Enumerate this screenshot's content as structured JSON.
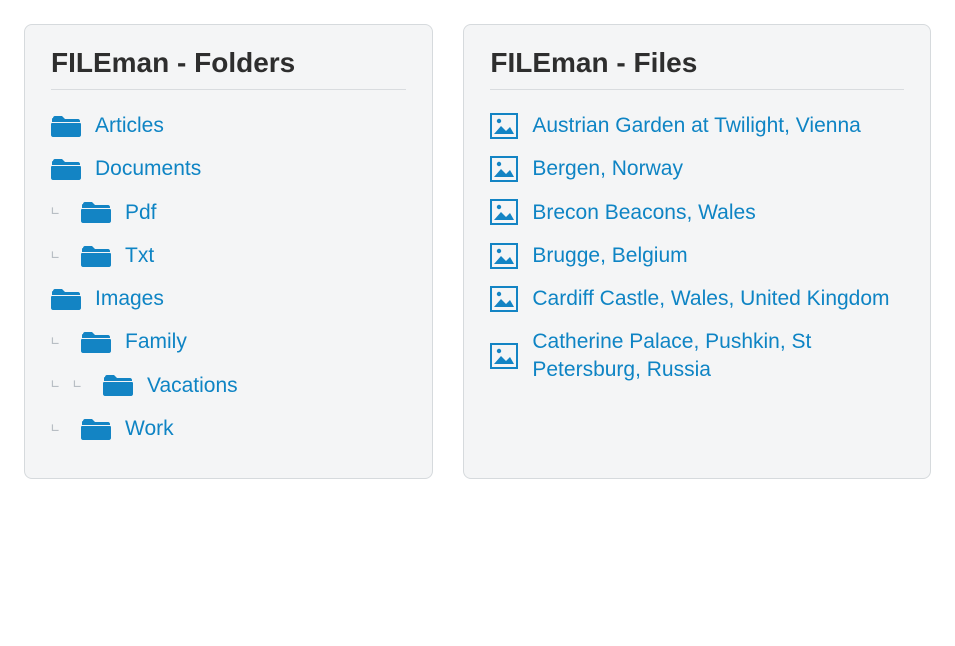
{
  "folders_panel": {
    "title": "FILEman - Folders",
    "items": [
      {
        "label": "Articles",
        "depth": 0
      },
      {
        "label": "Documents",
        "depth": 0
      },
      {
        "label": "Pdf",
        "depth": 1
      },
      {
        "label": "Txt",
        "depth": 1
      },
      {
        "label": "Images",
        "depth": 0
      },
      {
        "label": "Family",
        "depth": 1
      },
      {
        "label": "Vacations",
        "depth": 2
      },
      {
        "label": "Work",
        "depth": 1
      }
    ]
  },
  "files_panel": {
    "title": "FILEman - Files",
    "items": [
      {
        "label": "Austrian Garden at Twilight, Vienna"
      },
      {
        "label": "Bergen, Norway"
      },
      {
        "label": "Brecon Beacons, Wales"
      },
      {
        "label": "Brugge, Belgium"
      },
      {
        "label": "Cardiff Castle, Wales, United Kingdom"
      },
      {
        "label": "Catherine Palace, Pushkin, St Petersburg, Russia"
      }
    ]
  },
  "colors": {
    "link": "#0e84c4",
    "icon": "#1384c4",
    "panel_bg": "#f4f5f6",
    "panel_border": "#d6dadd"
  }
}
